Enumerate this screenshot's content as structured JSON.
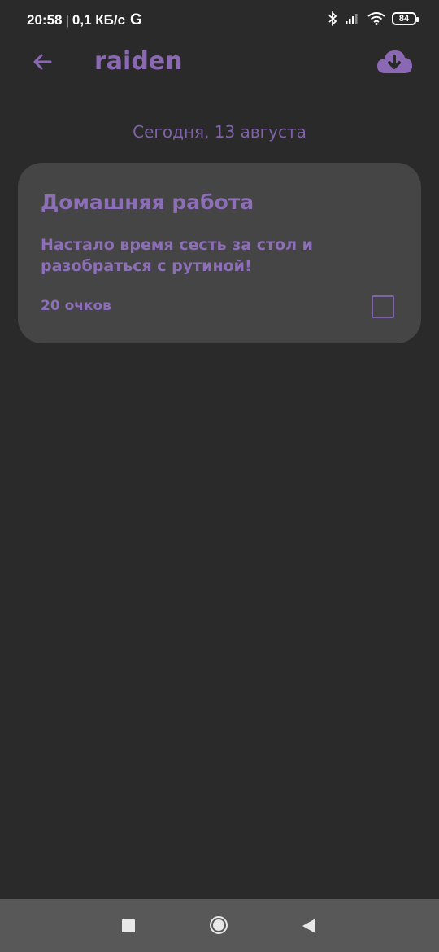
{
  "status_bar": {
    "time": "20:58",
    "separator": "|",
    "network_speed": "0,1 КБ/с",
    "g_label": "G",
    "battery": "84",
    "icons": [
      "bluetooth-icon",
      "signal-icon",
      "wifi-icon",
      "battery-icon"
    ]
  },
  "app_bar": {
    "title": "raiden",
    "back_icon": "arrow-left-icon",
    "action_icon": "cloud-download-icon"
  },
  "date_label": "Сегодня, 13 августа",
  "tasks": [
    {
      "title": "Домашняя работа",
      "description": "Настало время сесть за стол и разобраться с рутиной!",
      "points": "20 очков",
      "checked": false
    }
  ],
  "nav_bar": {
    "icons": [
      "recents-icon",
      "home-icon",
      "back-icon"
    ]
  },
  "colors": {
    "background": "#2a2a2a",
    "accent": "#8a68b3",
    "card": "#454545",
    "nav": "#585858"
  }
}
